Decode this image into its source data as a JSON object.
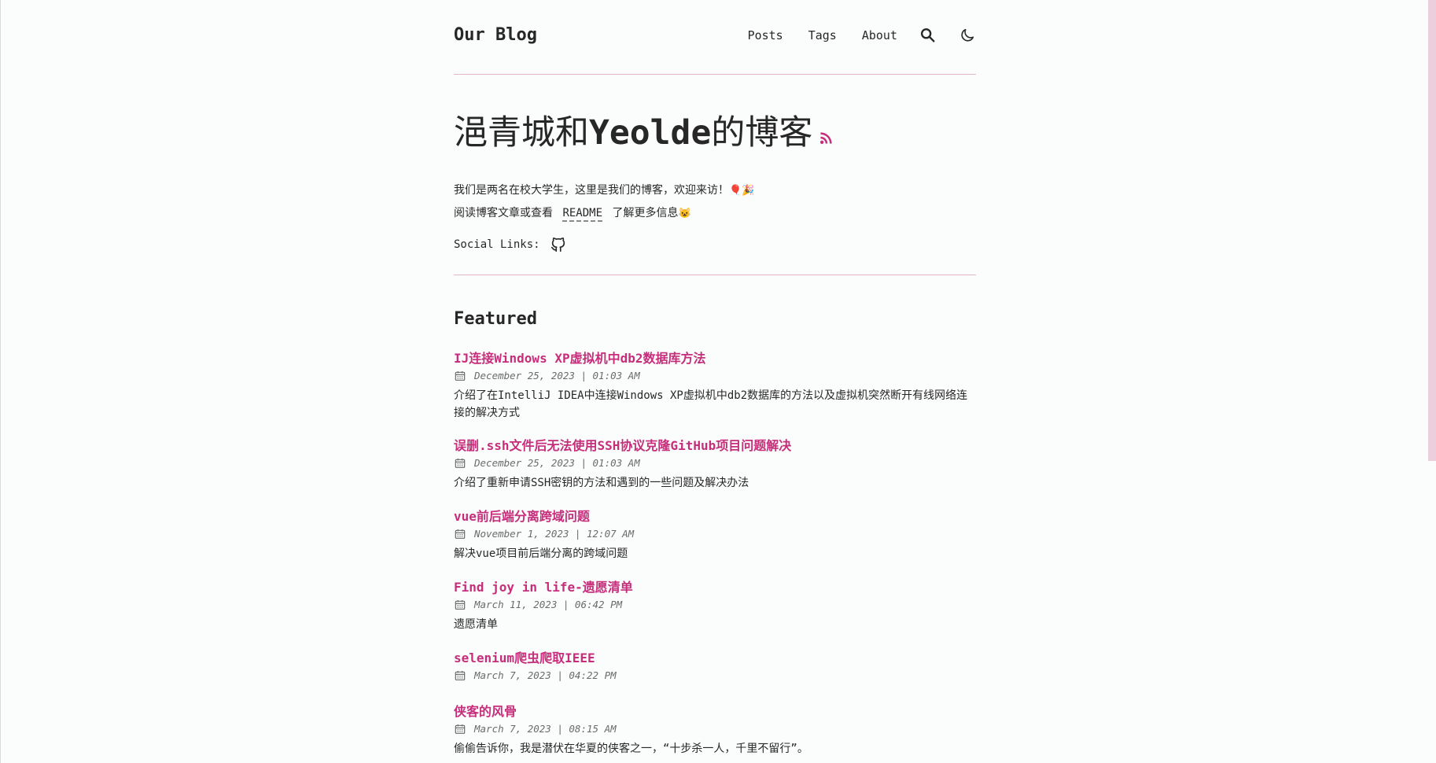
{
  "header": {
    "logo": "Our Blog",
    "nav": {
      "posts": "Posts",
      "tags": "Tags",
      "about": "About"
    }
  },
  "hero": {
    "title_part1": "浥青城和",
    "title_part2": "Yeolde",
    "title_part3": "的博客",
    "intro_line1": "我们是两名在校大学生，这里是我们的博客，欢迎来访！",
    "intro_line1_emoji": "🎈🎉",
    "intro_line2_prefix": "阅读博客文章或查看",
    "readme_label": "README",
    "intro_line2_suffix": "了解更多信息",
    "intro_line2_emoji": "😺",
    "social_label": "Social Links:"
  },
  "featured": {
    "heading": "Featured",
    "posts": [
      {
        "title": "IJ连接Windows XP虚拟机中db2数据库方法",
        "date": "December 25, 2023 | 01:03 AM",
        "description": "介绍了在IntelliJ IDEA中连接Windows XP虚拟机中db2数据库的方法以及虚拟机突然断开有线网络连接的解决方式"
      },
      {
        "title": "误删.ssh文件后无法使用SSH协议克隆GitHub项目问题解决",
        "date": "December 25, 2023 | 01:03 AM",
        "description": "介绍了重新申请SSH密钥的方法和遇到的一些问题及解决办法"
      },
      {
        "title": "vue前后端分离跨域问题",
        "date": "November 1, 2023 | 12:07 AM",
        "description": "解决vue项目前后端分离的跨域问题"
      },
      {
        "title": "Find joy in life-遗愿清单",
        "date": "March 11, 2023 | 06:42 PM",
        "description": "遗愿清单"
      },
      {
        "title": "selenium爬虫爬取IEEE",
        "date": "March 7, 2023 | 04:22 PM",
        "description": ""
      },
      {
        "title": "侠客的风骨",
        "date": "March 7, 2023 | 08:15 AM",
        "description": "偷偷告诉你，我是潜伏在华夏的侠客之一，“十步杀一人，千里不留行”。"
      }
    ]
  },
  "colors": {
    "accent": "#c62e7b",
    "divider": "#e3b5c9",
    "text": "#282728",
    "background": "#fbfcfc"
  }
}
